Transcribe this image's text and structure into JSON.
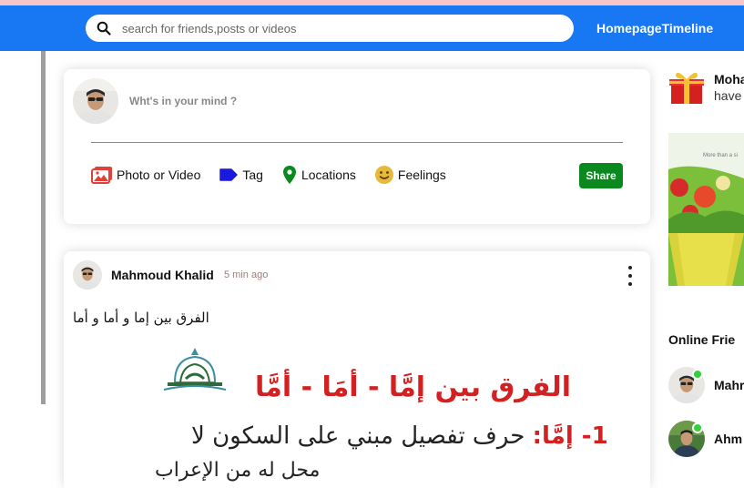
{
  "colors": {
    "topbar": "#1877f2",
    "share_button": "#0a8a1e",
    "online_dot": "#32d13a",
    "photo_icon": "#e0403a",
    "tag_icon": "#1a1adf",
    "location_icon": "#0a8a1e",
    "feelings_icon": "#e6b93a"
  },
  "topbar": {
    "search_placeholder": "search for friends,posts or videos",
    "links": [
      "Homepage",
      "Timeline"
    ]
  },
  "share": {
    "placeholder": "Wht's in your mind ?",
    "options": [
      {
        "label": "Photo or Video",
        "icon": "photo-icon"
      },
      {
        "label": "Tag",
        "icon": "tag-icon"
      },
      {
        "label": "Locations",
        "icon": "location-icon"
      },
      {
        "label": "Feelings",
        "icon": "emoji-icon"
      }
    ],
    "button": "Share"
  },
  "post": {
    "author": "Mahmoud Khalid",
    "time": "5 min ago",
    "text": "الفرق بين إما و أما و أما",
    "image": {
      "title": "الفرق بين إمَّا - أمَا - أمَّا",
      "line1_num": "1- إمَّا:",
      "line1_text": "حرف تفصيل مبني على السكون لا",
      "line2_text": "محل له من الإعراب"
    }
  },
  "rightbar": {
    "birthday_name": "Moha",
    "birthday_text": "have",
    "ad_caption": "More than a si",
    "online_title": "Online Frie",
    "friends": [
      {
        "name": "Mahr"
      },
      {
        "name": "Ahm"
      }
    ]
  }
}
